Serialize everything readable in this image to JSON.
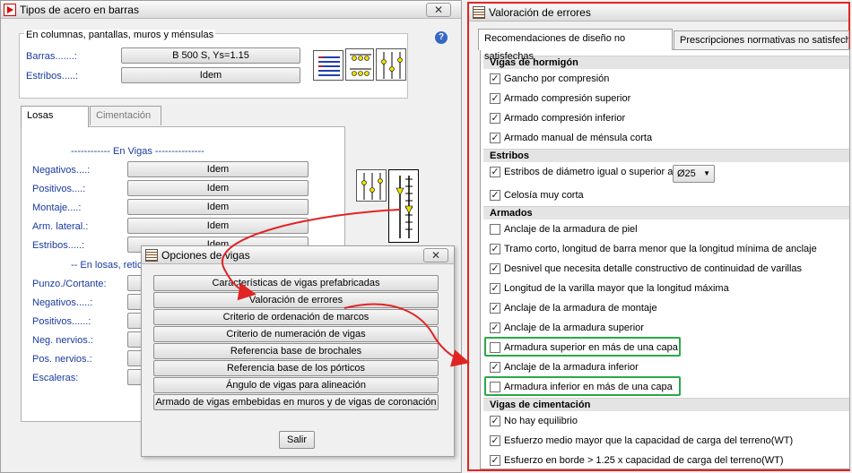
{
  "tipos": {
    "title": "Tipos de acero en barras",
    "close": "✕",
    "group_title": "En columnas, pantallas, muros y ménsulas",
    "barras_label": "Barras.......:",
    "barras_value": "B 500 S, Ys=1.15",
    "estribos_label": "Estribos.....:",
    "estribos_value": "Idem",
    "help": "?",
    "tabs": [
      "Losas",
      "Cimentación"
    ],
    "vigas_header": "------------ En Vigas ---------------",
    "vigas_rows": [
      {
        "label": "Negativos....:",
        "value": "Idem"
      },
      {
        "label": "Positivos....:",
        "value": "Idem"
      },
      {
        "label": "Montaje....:",
        "value": "Idem"
      },
      {
        "label": "Arm. lateral.:",
        "value": "Idem"
      },
      {
        "label": "Estribos.....:",
        "value": "Idem"
      }
    ],
    "losas_header": "-- En losas, reticu",
    "losas_rows": [
      "Punzo./Cortante:",
      "Negativos.....:",
      "Positivos......:",
      "Neg. nervios.:",
      "Pos. nervios.:",
      "Escaleras:"
    ]
  },
  "opciones": {
    "title": "Opciones de vigas",
    "close": "✕",
    "buttons": [
      "Características de vigas prefabricadas",
      "Valoración de errores",
      "Criterio de ordenación de marcos",
      "Criterio de numeración de vigas",
      "Referencia base de brochales",
      "Referencia base de los pórticos",
      "Ángulo de vigas para alineación",
      "Armado de vigas embebidas en muros y de vigas de coronación"
    ],
    "salir": "Salir"
  },
  "valoracion": {
    "title": "Valoración de errores",
    "tabs": [
      "Recomendaciones de diseño no satisfechas",
      "Prescripciones normativas no satisfechas"
    ],
    "sections": [
      {
        "title": "Vigas de hormigón",
        "items": [
          {
            "label": "Gancho por compresión",
            "checked": true
          },
          {
            "label": "Armado compresión superior",
            "checked": true
          },
          {
            "label": "Armado compresión inferior",
            "checked": true
          },
          {
            "label": "Armado manual de ménsula corta",
            "checked": true
          }
        ]
      },
      {
        "title": "Estribos",
        "items": [
          {
            "label": "Estribos de diámetro igual o superior a:",
            "checked": true,
            "select": "Ø25"
          },
          {
            "label": "Celosía muy corta",
            "checked": true
          }
        ]
      },
      {
        "title": "Armados",
        "items": [
          {
            "label": "Anclaje de la armadura de piel",
            "checked": false
          },
          {
            "label": "Tramo corto, longitud de barra menor que la longitud mínima de anclaje",
            "checked": true
          },
          {
            "label": "Desnivel que necesita detalle constructivo de continuidad de varillas",
            "checked": true
          },
          {
            "label": "Longitud de la varilla mayor que la longitud máxima",
            "checked": true
          },
          {
            "label": "Anclaje de la armadura de montaje",
            "checked": true
          },
          {
            "label": "Anclaje de la armadura superior",
            "checked": true
          },
          {
            "label": "Armadura superior en más de una capa",
            "checked": false
          },
          {
            "label": "Anclaje de la armadura inferior",
            "checked": true
          },
          {
            "label": "Armadura inferior en más de una capa",
            "checked": false
          }
        ]
      },
      {
        "title": "Vigas de cimentación",
        "items": [
          {
            "label": "No hay equilibrio",
            "checked": true
          },
          {
            "label": "Esfuerzo medio mayor que la capacidad de carga del terreno(WT)",
            "checked": true
          },
          {
            "label": "Esfuerzo en borde > 1.25 x capacidad de carga del terreno(WT)",
            "checked": true
          }
        ]
      }
    ]
  },
  "colors": {
    "highlight_red": "#e02424",
    "highlight_green": "#2ba84a"
  }
}
